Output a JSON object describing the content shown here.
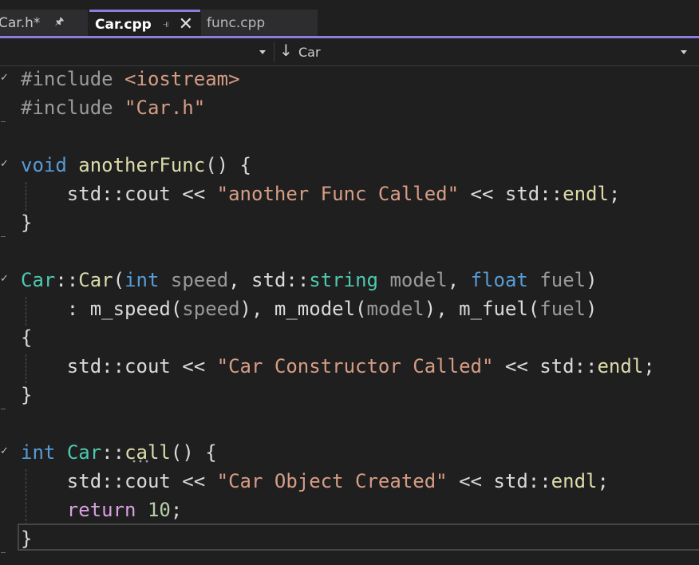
{
  "tabs": [
    {
      "label": "Car.h*",
      "pin_icon": "pin-icon",
      "active": false
    },
    {
      "label": "Car.cpp",
      "pin_icon": "pin-icon",
      "close_icon": "close-icon",
      "active": true
    },
    {
      "label": "func.cpp",
      "active": false
    }
  ],
  "navbar": {
    "scope_dropdown": "",
    "member_dropdown": "Car",
    "member_icon": "arrow-down-icon"
  },
  "colors": {
    "accent": "#8f7dde",
    "background": "#1f1f1f",
    "keyword": "#569cd6",
    "control_keyword": "#d8a0df",
    "preprocessor": "#9b9b9b",
    "string": "#d69d85",
    "type": "#4ec9b0",
    "function": "#dcdcaa",
    "parameter": "#9a9a9a",
    "number": "#b5cea8",
    "text": "#dadada"
  },
  "code": {
    "l1": [
      {
        "t": "pp",
        "v": "#include "
      },
      {
        "t": "str",
        "v": "<iostream>"
      }
    ],
    "l2": [
      {
        "t": "pp",
        "v": "#include "
      },
      {
        "t": "str",
        "v": "\"Car.h\""
      }
    ],
    "l3": [],
    "l4": [
      {
        "t": "kw",
        "v": "void"
      },
      {
        "t": "pl",
        "v": " "
      },
      {
        "t": "fn",
        "v": "anotherFunc"
      },
      {
        "t": "pl",
        "v": "() {"
      }
    ],
    "l5": [
      {
        "t": "pl",
        "v": "    std::cout << "
      },
      {
        "t": "str",
        "v": "\"another Func Called\""
      },
      {
        "t": "pl",
        "v": " << std::"
      },
      {
        "t": "fn",
        "v": "endl"
      },
      {
        "t": "pl",
        "v": ";"
      }
    ],
    "l6": [
      {
        "t": "pl",
        "v": "}"
      }
    ],
    "l7": [],
    "l8": [
      {
        "t": "typ",
        "v": "Car"
      },
      {
        "t": "pl",
        "v": "::"
      },
      {
        "t": "fn",
        "v": "Car"
      },
      {
        "t": "pl",
        "v": "("
      },
      {
        "t": "kw",
        "v": "int"
      },
      {
        "t": "pl",
        "v": " "
      },
      {
        "t": "prm",
        "v": "speed"
      },
      {
        "t": "pl",
        "v": ", std::"
      },
      {
        "t": "typ",
        "v": "string"
      },
      {
        "t": "pl",
        "v": " "
      },
      {
        "t": "prm",
        "v": "model"
      },
      {
        "t": "pl",
        "v": ", "
      },
      {
        "t": "kw",
        "v": "float"
      },
      {
        "t": "pl",
        "v": " "
      },
      {
        "t": "prm",
        "v": "fuel"
      },
      {
        "t": "pl",
        "v": ")"
      }
    ],
    "l9": [
      {
        "t": "pl",
        "v": "    : m_speed("
      },
      {
        "t": "prm",
        "v": "speed"
      },
      {
        "t": "pl",
        "v": "), m_model("
      },
      {
        "t": "prm",
        "v": "model"
      },
      {
        "t": "pl",
        "v": "), m_fuel("
      },
      {
        "t": "prm",
        "v": "fuel"
      },
      {
        "t": "pl",
        "v": ")"
      }
    ],
    "l10": [
      {
        "t": "pl",
        "v": "{"
      }
    ],
    "l11": [
      {
        "t": "pl",
        "v": "    std::cout << "
      },
      {
        "t": "str",
        "v": "\"Car Constructor Called\""
      },
      {
        "t": "pl",
        "v": " << std::"
      },
      {
        "t": "fn",
        "v": "endl"
      },
      {
        "t": "pl",
        "v": ";"
      }
    ],
    "l12": [
      {
        "t": "pl",
        "v": "}"
      }
    ],
    "l13": [],
    "l14": [
      {
        "t": "kw",
        "v": "int"
      },
      {
        "t": "pl",
        "v": " "
      },
      {
        "t": "typ",
        "v": "Car"
      },
      {
        "t": "pl",
        "v": "::"
      },
      {
        "t": "fn",
        "v": "call"
      },
      {
        "t": "pl",
        "v": "() {"
      }
    ],
    "l15": [
      {
        "t": "pl",
        "v": "    std::cout << "
      },
      {
        "t": "str",
        "v": "\"Car Object Created\""
      },
      {
        "t": "pl",
        "v": " << std::"
      },
      {
        "t": "fn",
        "v": "endl"
      },
      {
        "t": "pl",
        "v": ";"
      }
    ],
    "l16": [
      {
        "t": "pl",
        "v": "    "
      },
      {
        "t": "ctl",
        "v": "return"
      },
      {
        "t": "pl",
        "v": " "
      },
      {
        "t": "num",
        "v": "10"
      },
      {
        "t": "pl",
        "v": ";"
      }
    ],
    "l17": [
      {
        "t": "pl",
        "v": "}"
      }
    ]
  }
}
